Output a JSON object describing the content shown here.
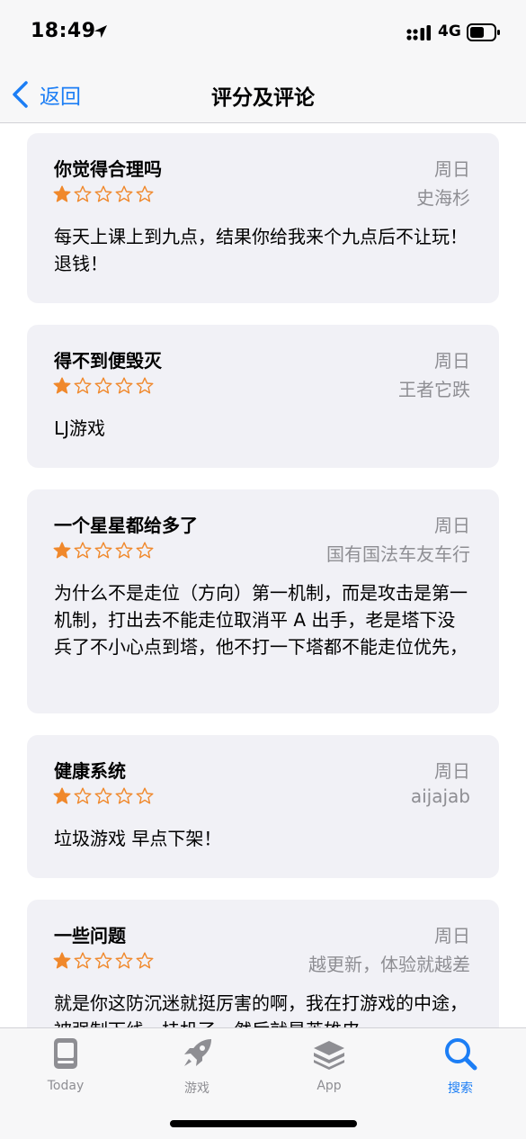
{
  "status_bar": {
    "time": "18:49",
    "network": "4G"
  },
  "nav": {
    "back_label": "返回",
    "title": "评分及评论"
  },
  "colors": {
    "accent": "#1c7ef5",
    "star": "#f0882b",
    "card_bg": "#f1f1f6",
    "secondary_text": "#8e8e93"
  },
  "reviews": [
    {
      "title": "你觉得合理吗",
      "date": "周日",
      "author": "史海杉",
      "rating": 1,
      "max_rating": 5,
      "body": "每天上课上到九点，结果你给我来个九点后不让玩！退钱！"
    },
    {
      "title": "得不到便毁灭",
      "date": "周日",
      "author": "王者它跌",
      "rating": 1,
      "max_rating": 5,
      "body": "LJ游戏"
    },
    {
      "title": "一个星星都给多了",
      "date": "周日",
      "author": "国有国法车友车行",
      "rating": 1,
      "max_rating": 5,
      "body": "为什么不是走位（方向）第一机制，而是攻击是第一机制，打出去不能走位取消平 A 出手，老是塔下没兵了不小心点到塔，他不打一下塔都不能走位优先，"
    },
    {
      "title": "健康系统",
      "date": "周日",
      "author": "aijajab",
      "rating": 1,
      "max_rating": 5,
      "body": "垃圾游戏 早点下架！"
    },
    {
      "title": "一些问题",
      "date": "周日",
      "author": "越更新，体验就越差",
      "rating": 1,
      "max_rating": 5,
      "body": "就是你这防沉迷就挺厉害的啊，我在打游戏的中途，被强制下线，挂机了，然后就是英雄皮"
    }
  ],
  "tabs": [
    {
      "label": "Today",
      "icon": "today-icon",
      "active": false
    },
    {
      "label": "游戏",
      "icon": "rocket-icon",
      "active": false
    },
    {
      "label": "App",
      "icon": "apps-stack-icon",
      "active": false
    },
    {
      "label": "搜索",
      "icon": "search-icon",
      "active": true
    }
  ]
}
